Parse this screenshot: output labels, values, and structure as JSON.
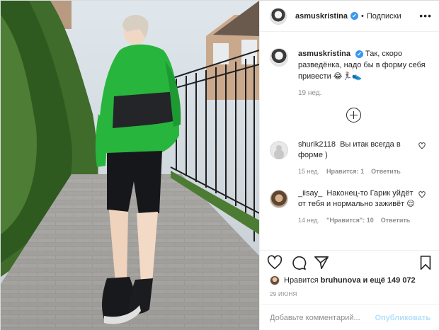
{
  "post": {
    "author": "asmuskristina",
    "follow_label": "Подписки",
    "dot": "•",
    "more_glyph": "•••",
    "verified_glyph": "✔"
  },
  "caption": {
    "author": "asmuskristina",
    "text": "Так, скоро разведёнка, надо бы в форму себя привести 😂🏃🏼‍♀️👟",
    "age": "19 нед."
  },
  "comments": [
    {
      "user": "shurik2118",
      "text": "Вы итак всегда в форме )",
      "age": "15 нед.",
      "likes": "Нравится: 1",
      "reply": "Ответить"
    },
    {
      "user": "_iisay_",
      "text": "Наконец-то Гарик уйдёт от тебя и нормально заживёт 😌",
      "age": "14 нед.",
      "likes": "\"Нравится\": 10",
      "reply": "Ответить"
    }
  ],
  "likes_line": {
    "prefix": "Нравится",
    "user": "bruhunova",
    "suffix": "и ещё 149 072"
  },
  "date": "29 ИЮНЯ",
  "add_comment": {
    "placeholder": "Добавьте комментарий...",
    "post_label": "Опубликовать"
  },
  "colors": {
    "accent": "#3897f0",
    "muted": "#8e8e8e",
    "post_disabled": "#b2dffc"
  },
  "icons": [
    "heart-icon",
    "comment-icon",
    "share-icon",
    "bookmark-icon",
    "plus-circle-icon",
    "verified-icon",
    "more-icon"
  ]
}
